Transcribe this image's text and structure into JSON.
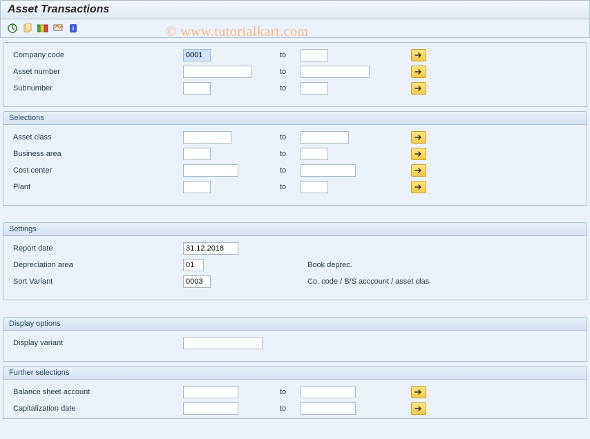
{
  "title": "Asset Transactions",
  "watermark": "© www.tutorialkart.com",
  "top_rows": [
    {
      "label": "Company code",
      "from": "0001",
      "to_label": "to",
      "to": "",
      "from_w": "w40 sel",
      "to_w": "w40",
      "multi": true
    },
    {
      "label": "Asset number",
      "from": "",
      "to_label": "to",
      "to": "",
      "from_w": "w100",
      "to_w": "w100",
      "multi": true
    },
    {
      "label": "Subnumber",
      "from": "",
      "to_label": "to",
      "to": "",
      "from_w": "w40",
      "to_w": "w40",
      "multi": true
    }
  ],
  "group_selections": {
    "title": "Selections",
    "rows": [
      {
        "label": "Asset class",
        "from": "",
        "to_label": "to",
        "to": "",
        "from_w": "w70",
        "to_w": "w70",
        "multi": true
      },
      {
        "label": "Business area",
        "from": "",
        "to_label": "to",
        "to": "",
        "from_w": "w40",
        "to_w": "w40",
        "multi": true
      },
      {
        "label": "Cost center",
        "from": "",
        "to_label": "to",
        "to": "",
        "from_w": "w80",
        "to_w": "w80",
        "multi": true
      },
      {
        "label": "Plant",
        "from": "",
        "to_label": "to",
        "to": "",
        "from_w": "w40",
        "to_w": "w40",
        "multi": true
      }
    ]
  },
  "group_settings": {
    "title": "Settings",
    "rows": [
      {
        "label": "Report date",
        "value": "31.12.2018",
        "w": "w80",
        "desc": ""
      },
      {
        "label": "Depreciation area",
        "value": "01",
        "w": "w30",
        "desc": "Book deprec."
      },
      {
        "label": "Sort Variant",
        "value": "0003",
        "w": "w40",
        "desc": "Co. code / B/S acccount / asset clas"
      }
    ]
  },
  "group_display": {
    "title": "Display options",
    "rows": [
      {
        "label": "Display variant",
        "value": "",
        "w": "w115"
      }
    ]
  },
  "group_further": {
    "title": "Further selections",
    "rows": [
      {
        "label": "Balance sheet account",
        "from": "",
        "to_label": "to",
        "to": "",
        "from_w": "w80",
        "to_w": "w80",
        "multi": true
      },
      {
        "label": "Capitalization date",
        "from": "",
        "to_label": "to",
        "to": "",
        "from_w": "w80",
        "to_w": "w80",
        "multi": true
      }
    ]
  }
}
